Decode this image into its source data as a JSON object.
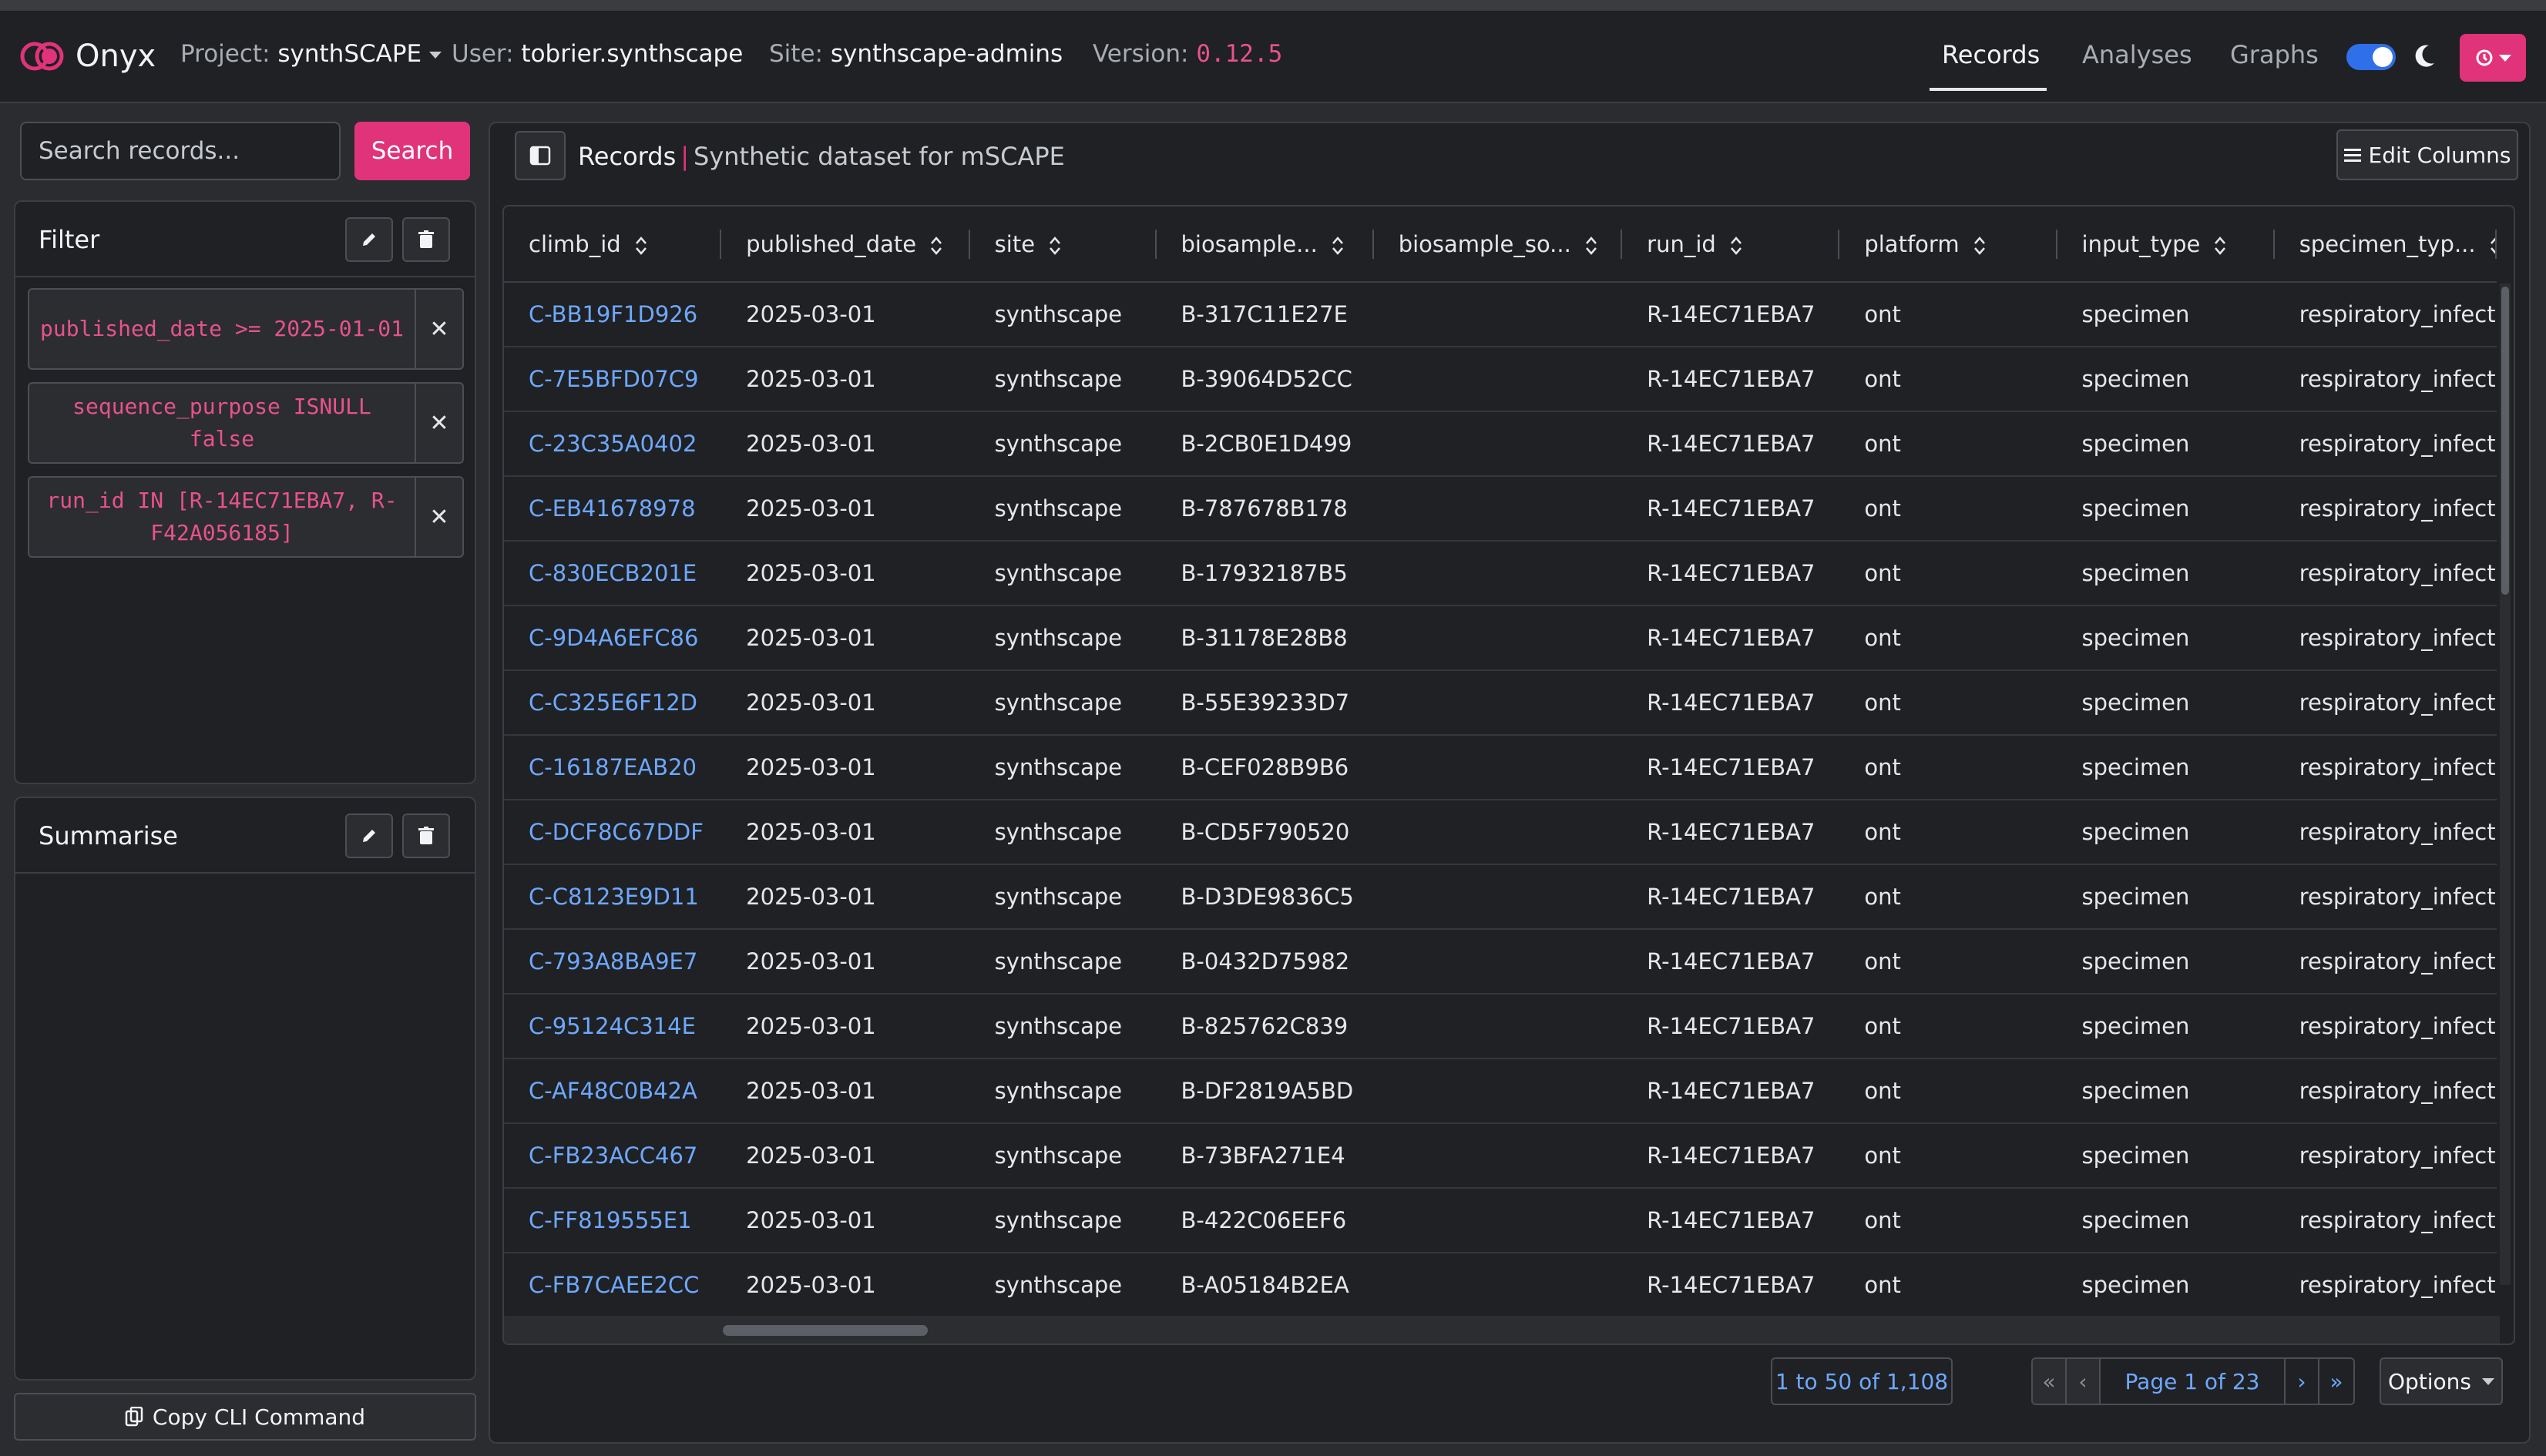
{
  "navbar": {
    "brand": "Onyx",
    "project_label": "Project:",
    "project_value": "synthSCAPE",
    "user_label": "User:",
    "user_value": "tobrier.synthscape",
    "site_label": "Site:",
    "site_value": "synthscape-admins",
    "version_label": "Version:",
    "version_value": "0.12.5",
    "links": [
      "Records",
      "Analyses",
      "Graphs"
    ],
    "active_link": "Records",
    "accent": "#e0337a"
  },
  "sidebar": {
    "search_placeholder": "Search records...",
    "search_button": "Search",
    "filter_title": "Filter",
    "filters": [
      "published_date >= 2025-01-01",
      "sequence_purpose ISNULL false",
      "run_id IN [R-14EC71EBA7, R-F42A056185]"
    ],
    "summarise_title": "Summarise",
    "copy_cli": "Copy CLI Command"
  },
  "main": {
    "crumb_title": "Records",
    "crumb_separator": "|",
    "crumb_desc": "Synthetic dataset for mSCAPE",
    "edit_columns": "Edit Columns",
    "columns": [
      "climb_id",
      "published_date",
      "site",
      "biosample...",
      "biosample_so...",
      "run_id",
      "platform",
      "input_type",
      "specimen_typ..."
    ],
    "rows": [
      [
        "C-BB19F1D926",
        "2025-03-01",
        "synthscape",
        "B-317C11E27E",
        "",
        "R-14EC71EBA7",
        "ont",
        "specimen",
        "respiratory_infecti..."
      ],
      [
        "C-7E5BFD07C9",
        "2025-03-01",
        "synthscape",
        "B-39064D52CC",
        "",
        "R-14EC71EBA7",
        "ont",
        "specimen",
        "respiratory_infecti..."
      ],
      [
        "C-23C35A0402",
        "2025-03-01",
        "synthscape",
        "B-2CB0E1D499",
        "",
        "R-14EC71EBA7",
        "ont",
        "specimen",
        "respiratory_infecti..."
      ],
      [
        "C-EB41678978",
        "2025-03-01",
        "synthscape",
        "B-787678B178",
        "",
        "R-14EC71EBA7",
        "ont",
        "specimen",
        "respiratory_infecti..."
      ],
      [
        "C-830ECB201E",
        "2025-03-01",
        "synthscape",
        "B-17932187B5",
        "",
        "R-14EC71EBA7",
        "ont",
        "specimen",
        "respiratory_infecti..."
      ],
      [
        "C-9D4A6EFC86",
        "2025-03-01",
        "synthscape",
        "B-31178E28B8",
        "",
        "R-14EC71EBA7",
        "ont",
        "specimen",
        "respiratory_infecti..."
      ],
      [
        "C-C325E6F12D",
        "2025-03-01",
        "synthscape",
        "B-55E39233D7",
        "",
        "R-14EC71EBA7",
        "ont",
        "specimen",
        "respiratory_infecti..."
      ],
      [
        "C-16187EAB20",
        "2025-03-01",
        "synthscape",
        "B-CEF028B9B6",
        "",
        "R-14EC71EBA7",
        "ont",
        "specimen",
        "respiratory_infecti..."
      ],
      [
        "C-DCF8C67DDF",
        "2025-03-01",
        "synthscape",
        "B-CD5F790520",
        "",
        "R-14EC71EBA7",
        "ont",
        "specimen",
        "respiratory_infecti..."
      ],
      [
        "C-C8123E9D11",
        "2025-03-01",
        "synthscape",
        "B-D3DE9836C5",
        "",
        "R-14EC71EBA7",
        "ont",
        "specimen",
        "respiratory_infecti..."
      ],
      [
        "C-793A8BA9E7",
        "2025-03-01",
        "synthscape",
        "B-0432D75982",
        "",
        "R-14EC71EBA7",
        "ont",
        "specimen",
        "respiratory_infecti..."
      ],
      [
        "C-95124C314E",
        "2025-03-01",
        "synthscape",
        "B-825762C839",
        "",
        "R-14EC71EBA7",
        "ont",
        "specimen",
        "respiratory_infecti..."
      ],
      [
        "C-AF48C0B42A",
        "2025-03-01",
        "synthscape",
        "B-DF2819A5BD",
        "",
        "R-14EC71EBA7",
        "ont",
        "specimen",
        "respiratory_infecti..."
      ],
      [
        "C-FB23ACC467",
        "2025-03-01",
        "synthscape",
        "B-73BFA271E4",
        "",
        "R-14EC71EBA7",
        "ont",
        "specimen",
        "respiratory_infecti..."
      ],
      [
        "C-FF819555E1",
        "2025-03-01",
        "synthscape",
        "B-422C06EEF6",
        "",
        "R-14EC71EBA7",
        "ont",
        "specimen",
        "respiratory_infecti..."
      ],
      [
        "C-FB7CAEE2CC",
        "2025-03-01",
        "synthscape",
        "B-A05184B2EA",
        "",
        "R-14EC71EBA7",
        "ont",
        "specimen",
        "respiratory_infecti..."
      ]
    ]
  },
  "pagination": {
    "range": "1 to 50 of 1,108",
    "first": "«",
    "prev": "‹",
    "page": "Page 1 of 23",
    "next": "›",
    "last": "»",
    "options": "Options"
  }
}
